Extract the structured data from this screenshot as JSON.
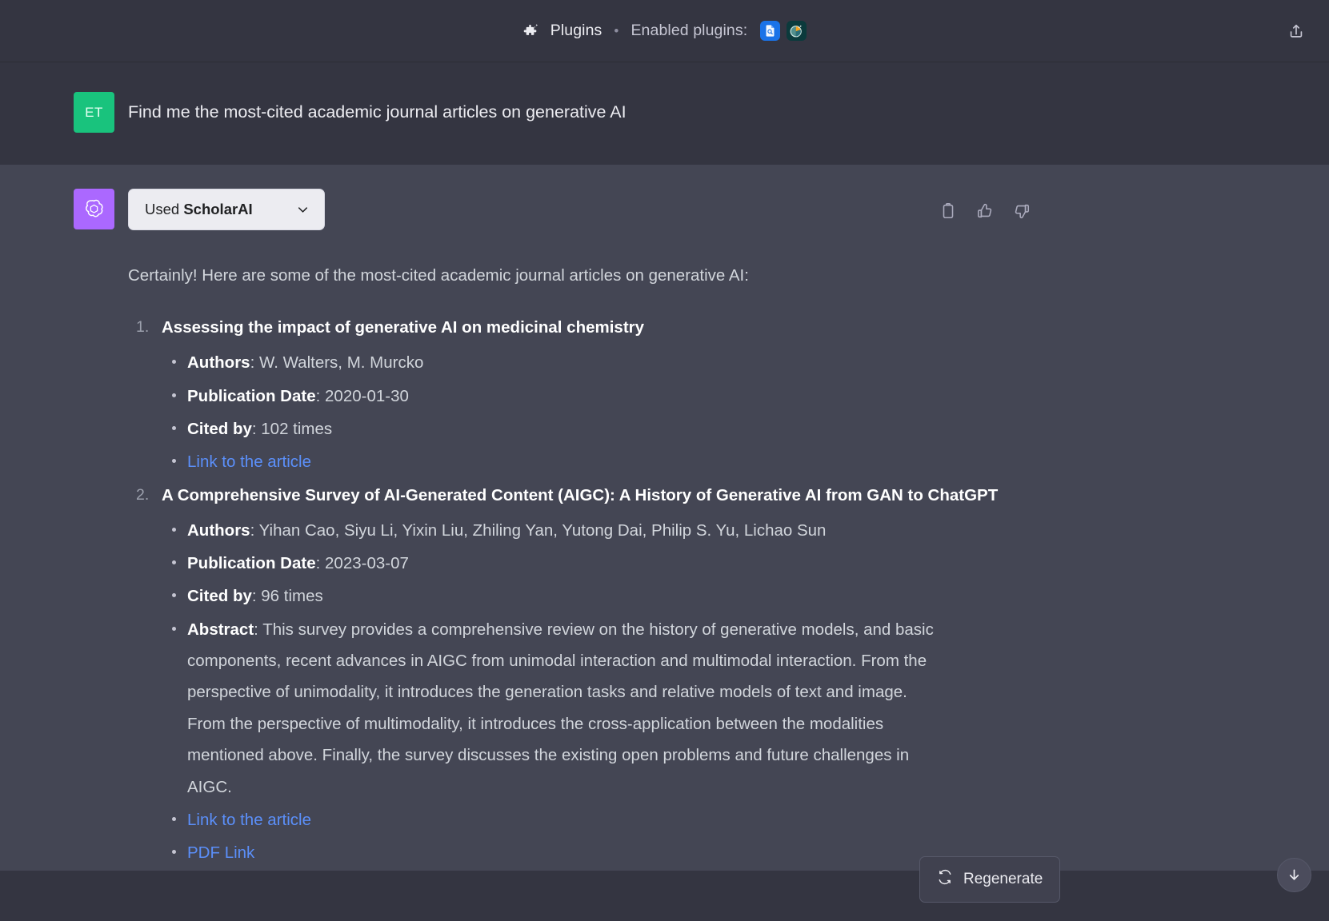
{
  "topbar": {
    "plugins_label": "Plugins",
    "separator": "•",
    "enabled_label": "Enabled plugins:",
    "plugins": [
      {
        "name": "scholarai-plugin-icon",
        "color": "#1a73e8"
      },
      {
        "name": "chart-plugin-icon",
        "color": "#0b3a3c"
      }
    ],
    "share_label": "share-icon"
  },
  "user_message": {
    "avatar_initials": "ET",
    "text": "Find me the most-cited academic journal articles on generative AI"
  },
  "assistant_message": {
    "plugin_pill": {
      "prefix": "Used ",
      "plugin_name": "ScholarAI"
    },
    "intro": "Certainly! Here are some of the most-cited academic journal articles on generative AI:",
    "actions": [
      "copy-icon",
      "thumbs-up-icon",
      "thumbs-down-icon"
    ],
    "articles": [
      {
        "title": "Assessing the impact of generative AI on medicinal chemistry",
        "fields": [
          {
            "label": "Authors",
            "value": "W. Walters, M. Murcko"
          },
          {
            "label": "Publication Date",
            "value": "2020-01-30"
          },
          {
            "label": "Cited by",
            "value": "102 times"
          }
        ],
        "links": [
          "Link to the article"
        ]
      },
      {
        "title": "A Comprehensive Survey of AI-Generated Content (AIGC): A History of Generative AI from GAN to ChatGPT",
        "fields": [
          {
            "label": "Authors",
            "value": "Yihan Cao, Siyu Li, Yixin Liu, Zhiling Yan, Yutong Dai, Philip S. Yu, Lichao Sun"
          },
          {
            "label": "Publication Date",
            "value": "2023-03-07"
          },
          {
            "label": "Cited by",
            "value": "96 times"
          },
          {
            "label": "Abstract",
            "value": "This survey provides a comprehensive review on the history of generative models, and basic components, recent advances in AIGC from unimodal interaction and multimodal interaction. From the perspective of unimodality, it introduces the generation tasks and relative models of text and image. From the perspective of multimodality, it introduces the cross-application between the modalities mentioned above. Finally, the survey discusses the existing open problems and future challenges in AIGC."
          }
        ],
        "links": [
          "Link to the article",
          "PDF Link"
        ]
      }
    ]
  },
  "footer": {
    "regenerate_label": "Regenerate",
    "scroll_bottom_label": "scroll-to-bottom-icon"
  },
  "colors": {
    "user_row_bg": "#343541",
    "assistant_row_bg": "#444654",
    "accent_green": "#19c37d",
    "accent_purple": "#ab68ff",
    "link_blue": "#5b8ff9"
  }
}
